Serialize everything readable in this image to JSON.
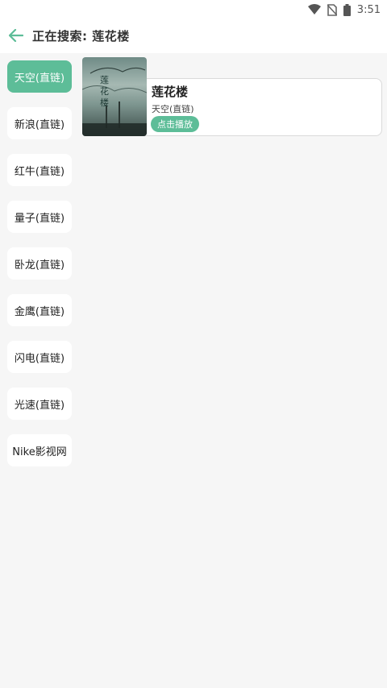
{
  "status_bar": {
    "time": "3:51",
    "icons": [
      "wifi-icon",
      "no-sim-icon",
      "battery-icon"
    ]
  },
  "header": {
    "back_icon": "arrow-left-icon",
    "title": "正在搜索: 莲花楼"
  },
  "sources": [
    {
      "label": "天空(直链)",
      "active": true
    },
    {
      "label": "新浪(直链)",
      "active": false
    },
    {
      "label": "红牛(直链)",
      "active": false
    },
    {
      "label": "量子(直链)",
      "active": false
    },
    {
      "label": "卧龙(直链)",
      "active": false
    },
    {
      "label": "金鹰(直链)",
      "active": false
    },
    {
      "label": "闪电(直链)",
      "active": false
    },
    {
      "label": "光速(直链)",
      "active": false
    },
    {
      "label": "Nike影视网",
      "active": false
    }
  ],
  "results": [
    {
      "title": "莲花楼",
      "source": "天空(直链)",
      "play_label": "点击播放"
    }
  ],
  "colors": {
    "accent": "#5dbd98",
    "background": "#f6f6f6"
  }
}
